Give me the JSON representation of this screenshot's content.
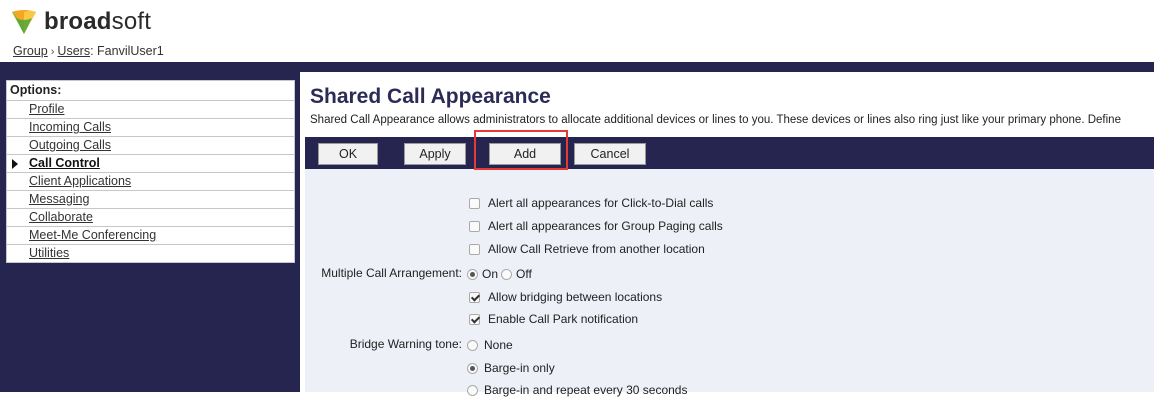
{
  "brand": {
    "text_bold": "broad",
    "text_regular": "soft"
  },
  "breadcrumb": {
    "group": "Group",
    "sep1": "›",
    "users": "Users",
    "current": ": FanvilUser1"
  },
  "sidebar": {
    "title": "Options:",
    "items": [
      {
        "label": "Profile"
      },
      {
        "label": "Incoming Calls"
      },
      {
        "label": "Outgoing Calls"
      },
      {
        "label": "Call Control",
        "active": true
      },
      {
        "label": "Client Applications"
      },
      {
        "label": "Messaging"
      },
      {
        "label": "Collaborate"
      },
      {
        "label": "Meet-Me Conferencing"
      },
      {
        "label": "Utilities"
      }
    ]
  },
  "main": {
    "title": "Shared Call Appearance",
    "description": "Shared Call Appearance allows administrators to allocate additional devices or lines to you. These devices or lines also ring just like your primary phone. Define"
  },
  "toolbar": {
    "ok": "OK",
    "apply": "Apply",
    "add": "Add",
    "cancel": "Cancel"
  },
  "options": {
    "alert_click_to_dial": {
      "label": "Alert all appearances for Click-to-Dial calls",
      "checked": false
    },
    "alert_group_paging": {
      "label": "Alert all appearances for Group Paging calls",
      "checked": false
    },
    "allow_call_retrieve": {
      "label": "Allow Call Retrieve from another location",
      "checked": false
    },
    "multiple_call_arrangement": {
      "label": "Multiple Call Arrangement:",
      "on": "On",
      "off": "Off",
      "selected": "On"
    },
    "allow_bridging": {
      "label": "Allow bridging between locations",
      "checked": true
    },
    "enable_call_park": {
      "label": "Enable Call Park notification",
      "checked": true
    },
    "bridge_warning_tone": {
      "label": "Bridge Warning tone:",
      "none": "None",
      "barge_in_only": "Barge-in only",
      "barge_in_repeat": "Barge-in and repeat every 30 seconds",
      "selected": "Barge-in only"
    }
  },
  "colors": {
    "navy": "#25254f",
    "title": "#2b2b56",
    "highlight": "#e53935",
    "panel": "#eef0f7",
    "logo_orange": "#f5a623",
    "logo_green": "#7cc242"
  }
}
